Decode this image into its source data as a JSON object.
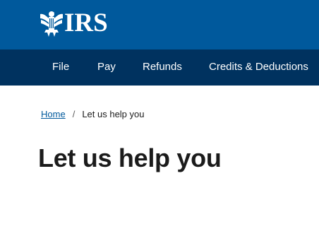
{
  "header": {
    "logo_text": "IRS",
    "logo_icon": "eagle-emblem-icon",
    "background_color": "#00599c"
  },
  "nav": {
    "background_color": "#00325f",
    "items": [
      {
        "label": "File"
      },
      {
        "label": "Pay"
      },
      {
        "label": "Refunds"
      },
      {
        "label": "Credits & Deductions"
      }
    ]
  },
  "breadcrumb": {
    "home_label": "Home",
    "separator": "/",
    "current_label": "Let us help you"
  },
  "main": {
    "title": "Let us help you"
  }
}
